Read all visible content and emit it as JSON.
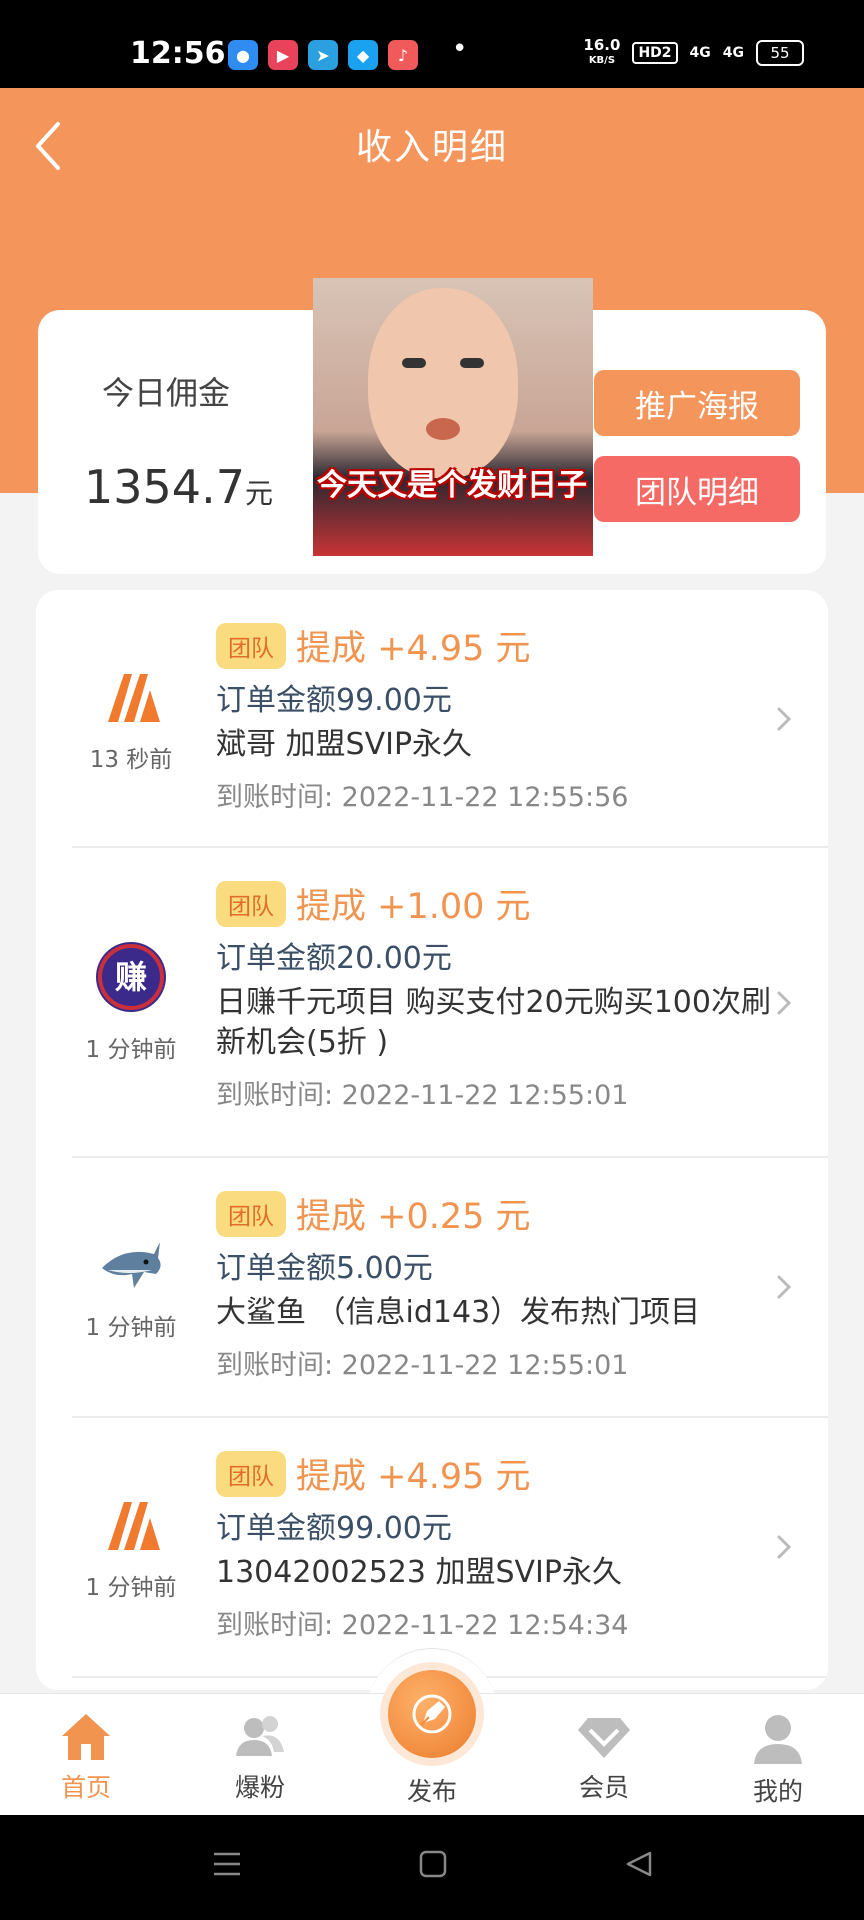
{
  "status_bar": {
    "time": "12:56",
    "net_speed": "16.0",
    "net_unit": "KB/S",
    "hd": "HD2",
    "signal1": "4G",
    "signal2": "4G",
    "battery": "55",
    "dot": "•"
  },
  "header": {
    "title": "收入明细"
  },
  "summary": {
    "today_label": "今日佣金",
    "today_amount": "1354.7",
    "amount_unit": "元",
    "poster_button": "推广海报",
    "team_button": "团队明细"
  },
  "meme": {
    "caption": "今天又是个发财日子"
  },
  "records": [
    {
      "icon": "brand-stripes-icon",
      "time_ago": "13 秒前",
      "tag": "团队",
      "commission": "提成 +4.95 元",
      "order_amount": "订单金额99.00元",
      "product": "斌哥 加盟SVIP永久",
      "arrived": "到账时间: 2022-11-22 12:55:56"
    },
    {
      "icon": "zhuan-coin-icon",
      "time_ago": "1 分钟前",
      "tag": "团队",
      "commission": "提成 +1.00 元",
      "order_amount": "订单金额20.00元",
      "product": "日赚千元项目 购买支付20元购买100次刷新机会(5折 )",
      "arrived": "到账时间: 2022-11-22 12:55:01"
    },
    {
      "icon": "shark-icon",
      "time_ago": "1 分钟前",
      "tag": "团队",
      "commission": "提成 +0.25 元",
      "order_amount": "订单金额5.00元",
      "product": "大鲨鱼 （信息id143）发布热门项目",
      "arrived": "到账时间: 2022-11-22 12:55:01"
    },
    {
      "icon": "brand-stripes-icon",
      "time_ago": "1 分钟前",
      "tag": "团队",
      "commission": "提成 +4.95 元",
      "order_amount": "订单金额99.00元",
      "product": "13042002523 加盟SVIP永久",
      "arrived": "到账时间: 2022-11-22 12:54:34"
    }
  ],
  "zhuan_char": "赚",
  "tabbar": {
    "home": "首页",
    "fans": "爆粉",
    "publish": "发布",
    "member": "会员",
    "mine": "我的"
  },
  "colors": {
    "brand_orange": "#f4955c",
    "team_red": "#f56a64",
    "tag_yellow": "#fbdb7f"
  }
}
